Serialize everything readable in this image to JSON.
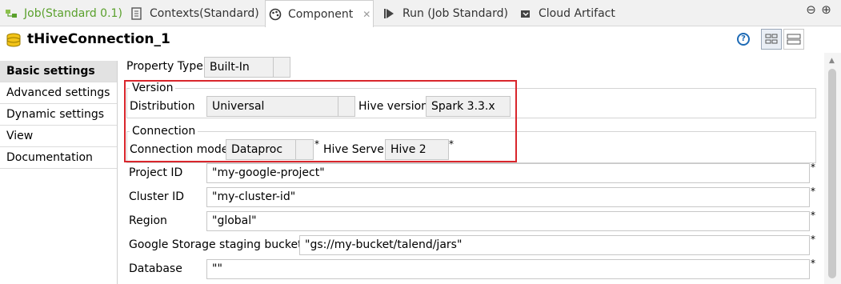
{
  "tabs": [
    {
      "label": "Job(Standard 0.1)",
      "icon": "job-icon"
    },
    {
      "label": "Contexts(Standard)",
      "icon": "contexts-icon"
    },
    {
      "label": "Component",
      "icon": "component-icon",
      "active": true
    },
    {
      "label": "Run (Job Standard)",
      "icon": "run-icon"
    },
    {
      "label": "Cloud Artifact",
      "icon": "cloud-artifact-icon"
    }
  ],
  "window_controls": {
    "minimize": "⊖",
    "maximize": "⊕"
  },
  "component_title": "tHiveConnection_1",
  "help_symbol": "?",
  "nav": [
    {
      "label": "Basic settings",
      "selected": true
    },
    {
      "label": "Advanced settings"
    },
    {
      "label": "Dynamic settings"
    },
    {
      "label": "View"
    },
    {
      "label": "Documentation"
    }
  ],
  "form": {
    "property_type_label": "Property Type",
    "property_type_value": "Built-In",
    "version_group": "Version",
    "distribution_label": "Distribution",
    "distribution_value": "Universal",
    "hive_version_label": "Hive version",
    "hive_version_value": "Spark 3.3.x",
    "connection_group": "Connection",
    "connection_mode_label": "Connection mode",
    "connection_mode_value": "Dataproc",
    "hive_server_label": "Hive Server",
    "hive_server_value": "Hive 2",
    "project_id_label": "Project ID",
    "project_id_value": "\"my-google-project\"",
    "cluster_id_label": "Cluster ID",
    "cluster_id_value": "\"my-cluster-id\"",
    "region_label": "Region",
    "region_value": "\"global\"",
    "bucket_label": "Google Storage staging bucket",
    "bucket_value": "\"gs://my-bucket/talend/jars\"",
    "database_label": "Database",
    "database_value": "\"\"",
    "required_marker": "*"
  },
  "colors": {
    "highlight": "#d9262c",
    "job_tab_text": "#5aa02c",
    "selected_nav": "#e2e2e2"
  }
}
